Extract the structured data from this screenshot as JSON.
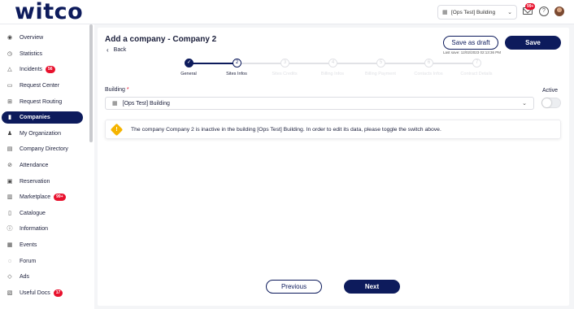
{
  "header": {
    "logo": "witco",
    "building_selector": "[Ops Test] Building",
    "mail_badge": "99+"
  },
  "sidebar": {
    "items": [
      {
        "label": "Overview",
        "icon": "eye-icon"
      },
      {
        "label": "Statistics",
        "icon": "clock-icon"
      },
      {
        "label": "Incidents",
        "icon": "warning-icon",
        "badge": "56"
      },
      {
        "label": "Request Center",
        "icon": "message-icon"
      },
      {
        "label": "Request Routing",
        "icon": "routing-icon"
      },
      {
        "label": "Companies",
        "icon": "building-icon",
        "active": true
      },
      {
        "label": "My Organization",
        "icon": "people-icon"
      },
      {
        "label": "Company Directory",
        "icon": "directory-icon"
      },
      {
        "label": "Attendance",
        "icon": "check-circle-icon"
      },
      {
        "label": "Reservation",
        "icon": "calendar-icon"
      },
      {
        "label": "Marketplace",
        "icon": "store-icon",
        "badge": "99+"
      },
      {
        "label": "Catalogue",
        "icon": "book-icon"
      },
      {
        "label": "Information",
        "icon": "info-icon"
      },
      {
        "label": "Events",
        "icon": "event-icon"
      },
      {
        "label": "Forum",
        "icon": "chat-icon"
      },
      {
        "label": "Ads",
        "icon": "tag-icon"
      },
      {
        "label": "Useful Docs",
        "icon": "document-icon",
        "badge": "17"
      }
    ]
  },
  "main": {
    "title": "Add a company - Company 2",
    "back_label": "Back",
    "save_draft_label": "Save as draft",
    "save_label": "Save",
    "last_save": "Last save: 12/02/2023 02:13:36 PM",
    "steps": [
      {
        "num": "",
        "label": "General",
        "state": "done"
      },
      {
        "num": "2",
        "label": "Sites Infos",
        "state": "current"
      },
      {
        "num": "3",
        "label": "Sites Credits",
        "state": "todo"
      },
      {
        "num": "4",
        "label": "Billing Infos",
        "state": "todo"
      },
      {
        "num": "5",
        "label": "Billing Payment",
        "state": "todo"
      },
      {
        "num": "6",
        "label": "Contacts Infos",
        "state": "todo"
      },
      {
        "num": "7",
        "label": "Contract Details",
        "state": "todo"
      }
    ],
    "building_label": "Building",
    "required_mark": "*",
    "building_value": "[Ops Test] Building",
    "active_label": "Active",
    "active_value": false,
    "alert_text": "The company Company 2 is inactive in the building [Ops Test] Building. In order to edit its data, please toggle the switch above.",
    "previous_label": "Previous",
    "next_label": "Next"
  },
  "colors": {
    "primary": "#0d1b5c",
    "badge": "#e8112d",
    "warning": "#f5b400"
  }
}
